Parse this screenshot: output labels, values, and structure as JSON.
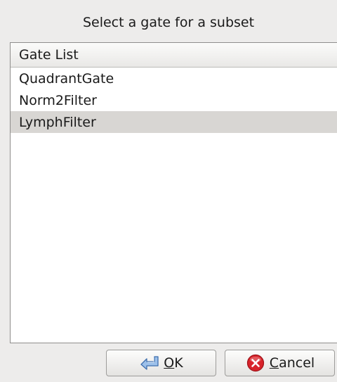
{
  "dialog": {
    "prompt": "Select a gate for a subset"
  },
  "gate_list": {
    "header": "Gate List",
    "items": [
      {
        "label": "QuadrantGate",
        "selected": false
      },
      {
        "label": "Norm2Filter",
        "selected": false
      },
      {
        "label": "LymphFilter",
        "selected": true
      }
    ]
  },
  "buttons": {
    "ok": {
      "mnemonic": "O",
      "rest": "K",
      "icon": "ok-return-icon"
    },
    "cancel": {
      "mnemonic": "C",
      "rest": "ancel",
      "icon": "cancel-x-icon"
    }
  },
  "colors": {
    "selected_row": "#d8d6d3",
    "cancel_icon": "#d8232a",
    "ok_icon": "#5a8fd0"
  }
}
